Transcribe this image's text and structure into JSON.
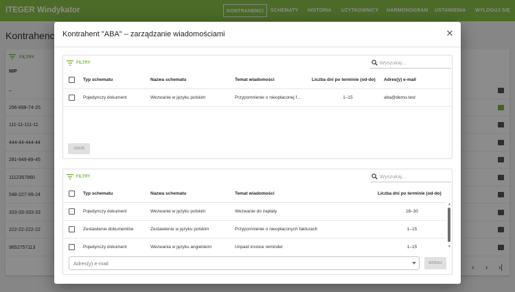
{
  "app": {
    "title": "ITEGER Windykator",
    "nav": [
      "KONTRAHENCI",
      "SCHEMATY",
      "HISTORIA",
      "UŻYTKOWNICY",
      "HARMONOGRAM",
      "USTAWIENIA",
      "WYLOGUJ SIĘ"
    ],
    "active_nav": "KONTRAHENCI",
    "accent_color": "#8bc34a"
  },
  "background": {
    "heading": "Kontrahenci",
    "filter_label": "FILTRY",
    "column_header": "NIP",
    "nip_values": [
      "–",
      "296-898-74-25",
      "111-11-111-11",
      "444-44-444-44",
      "281-949-89-45",
      "1112357860",
      "548-227-99-24",
      "333-33-333-33",
      "222-22-222-22",
      "9652757113"
    ]
  },
  "dialog": {
    "title": "Kontrahent \"ABA\" – zarządzanie wiadomościami",
    "close_icon": "close-icon",
    "assigned": {
      "filter_label": "FILTRY",
      "search_placeholder": "Wyszukaj...",
      "columns": [
        "Typ schematu",
        "Nazwa schematu",
        "Temat wiadomości",
        "Liczba dni po terminie (od-do)",
        "Adres(y) e-mail"
      ],
      "rows": [
        {
          "type": "Pojedynczy dokument",
          "name": "Wezwanie w języku polskim",
          "subject": "Przypomnienie o nieopłaconej f...",
          "days": "1–15",
          "email": "aba@demo.test"
        }
      ],
      "delete_label": "USUŃ"
    },
    "available": {
      "filter_label": "FILTRY",
      "search_placeholder": "Wyszukaj...",
      "columns": [
        "Typ schematu",
        "Nazwa schematu",
        "Temat wiadomości",
        "Liczba dni po terminie (od-do)"
      ],
      "rows": [
        {
          "type": "Pojedynczy dokument",
          "name": "Wezwanie w języku polskim",
          "subject": "Wezwanie do zapłaty",
          "days": "16–30"
        },
        {
          "type": "Zestawienie dokumentów",
          "name": "Zestawienie w języku polskim",
          "subject": "Przypomnienie o nieopłaconych fakturach",
          "days": "1–15"
        },
        {
          "type": "Pojedynczy dokument",
          "name": "Wezwania w języku angielskim",
          "subject": "Unpaid invoice reminder",
          "days": "1–15"
        }
      ],
      "email_placeholder": "Adres(y) e-mail",
      "add_label": "DODAJ"
    }
  }
}
